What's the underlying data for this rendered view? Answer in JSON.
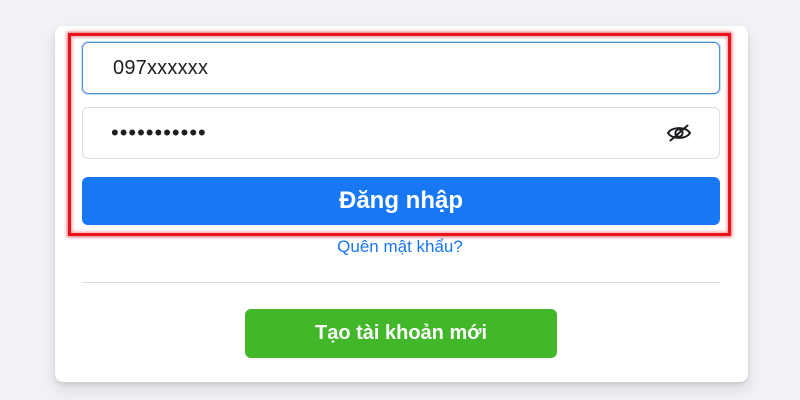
{
  "login_form": {
    "phone_value": "097xxxxxx",
    "password_value": "•••••••••••",
    "toggle_visibility_icon": "eye-slash-icon",
    "login_label": "Đăng nhập",
    "forgot_password_label": "Quên mật khẩu?",
    "create_account_label": "Tạo tài khoản mới"
  },
  "colors": {
    "primary": "#1877f2",
    "success": "#42b72a",
    "highlight": "#e8141c",
    "background": "#f0f2f5"
  }
}
